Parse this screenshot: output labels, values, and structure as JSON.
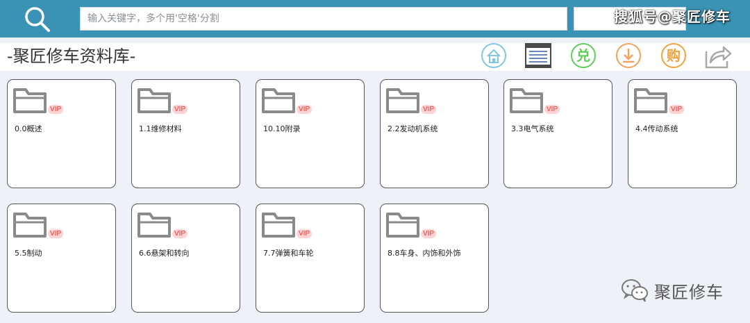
{
  "header": {
    "search_placeholder": "输入关键字，多个用'空格'分割",
    "watermark": "搜狐号@聚匠修车"
  },
  "page": {
    "title": "-聚匠修车资料库-"
  },
  "toolbar": [
    {
      "name": "home",
      "icon": "home-icon",
      "color": "#7fc7de"
    },
    {
      "name": "catalog",
      "icon": "document-window-icon",
      "color": "#4a4a4a"
    },
    {
      "name": "redeem",
      "label": "兑",
      "icon": "redeem-icon",
      "color": "#5fce59"
    },
    {
      "name": "download",
      "icon": "download-icon",
      "color": "#f1a25e"
    },
    {
      "name": "buy",
      "label": "购",
      "icon": "buy-icon",
      "color": "#f0a23d"
    },
    {
      "name": "share",
      "icon": "share-icon",
      "color": "#a8a8a8"
    }
  ],
  "folders": [
    {
      "label": "0.0概述",
      "badge": "VIP"
    },
    {
      "label": "1.1维修材料",
      "badge": "VIP"
    },
    {
      "label": "10.10附录",
      "badge": "VIP"
    },
    {
      "label": "2.2发动机系统",
      "badge": "VIP"
    },
    {
      "label": "3.3电气系统",
      "badge": "VIP"
    },
    {
      "label": "4.4传动系统",
      "badge": "VIP"
    },
    {
      "label": "5.5制动",
      "badge": "VIP"
    },
    {
      "label": "6.6悬架和转向",
      "badge": "VIP"
    },
    {
      "label": "7.7弹簧和车轮",
      "badge": "VIP"
    },
    {
      "label": "8.8车身、内饰和外饰",
      "badge": "VIP"
    }
  ],
  "footer": {
    "wechat_watermark": "聚匠修车"
  },
  "colors": {
    "header_bg": "#3a92b4",
    "page_bg": "#eef1f7",
    "vip_text": "#e53935",
    "vip_bg": "#ffd3d3"
  }
}
